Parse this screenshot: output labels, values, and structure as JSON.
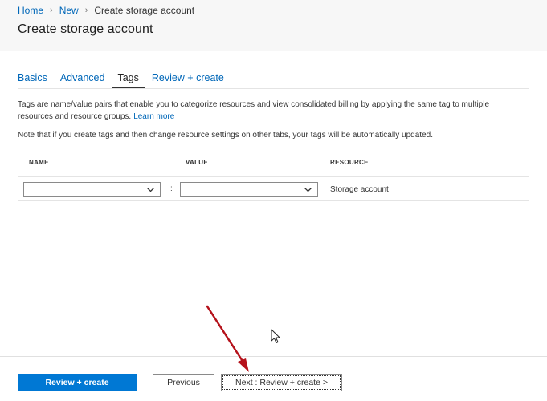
{
  "breadcrumb": {
    "items": [
      "Home",
      "New"
    ],
    "current": "Create storage account"
  },
  "page": {
    "title": "Create storage account"
  },
  "tabs": [
    {
      "label": "Basics",
      "active": false
    },
    {
      "label": "Advanced",
      "active": false
    },
    {
      "label": "Tags",
      "active": true
    },
    {
      "label": "Review + create",
      "active": false
    }
  ],
  "tags_tab": {
    "description": "Tags are name/value pairs that enable you to categorize resources and view consolidated billing by applying the same tag to multiple resources and resource groups.",
    "learn_more": "Learn more",
    "note": "Note that if you create tags and then change resource settings on other tabs, your tags will be automatically updated.",
    "columns": {
      "name": "NAME",
      "value": "VALUE",
      "resource": "RESOURCE"
    },
    "row": {
      "name_value": "",
      "separator": ":",
      "value_value": "",
      "resource": "Storage account"
    }
  },
  "footer": {
    "review_create": "Review + create",
    "previous": "Previous",
    "next": "Next : Review + create >"
  },
  "colors": {
    "link": "#0067b8",
    "primary_button": "#0078d4",
    "annotation_arrow": "#b5121b"
  },
  "icons": {
    "breadcrumb_separator": "chevron-right-icon",
    "dropdown": "chevron-down-icon",
    "cursor": "mouse-pointer-icon"
  }
}
